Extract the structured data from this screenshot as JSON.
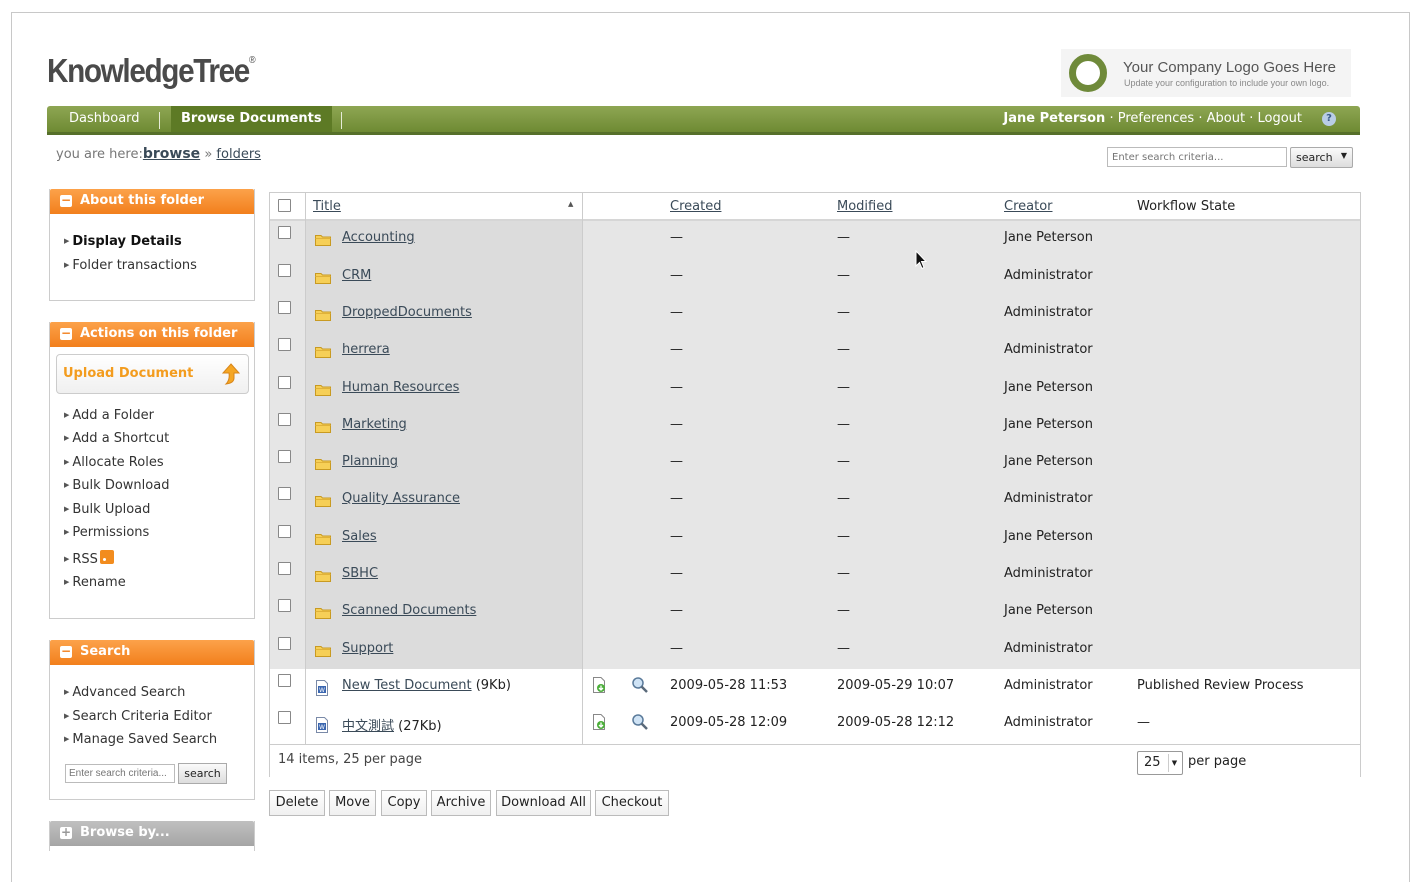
{
  "header": {
    "logo_main": "KnowledgeTree",
    "logo_mark": "®",
    "company_title": "Your Company Logo Goes Here",
    "company_sub": "Update your configuration to include your own logo."
  },
  "nav": {
    "tabs": [
      {
        "label": "Dashboard"
      },
      {
        "label": "Browse Documents"
      }
    ],
    "user": "Jane Peterson",
    "preferences": "Preferences",
    "about": "About",
    "logout": "Logout",
    "dot": "·",
    "help_glyph": "?"
  },
  "breadcrumb": {
    "prefix": "you are here:",
    "browse": "browse",
    "sep": "»",
    "folders": "folders"
  },
  "top_search": {
    "placeholder": "Enter search criteria...",
    "button": "search"
  },
  "sidebar": {
    "about": {
      "title": "About this folder",
      "items": [
        "Display Details",
        "Folder transactions"
      ]
    },
    "actions": {
      "title": "Actions on this folder",
      "upload": "Upload Document",
      "items": [
        "Add a Folder",
        "Add a Shortcut",
        "Allocate Roles",
        "Bulk Download",
        "Bulk Upload",
        "Permissions",
        "RSS",
        "Rename"
      ]
    },
    "search": {
      "title": "Search",
      "items": [
        "Advanced Search",
        "Search Criteria Editor",
        "Manage Saved Search"
      ],
      "placeholder": "Enter search criteria...",
      "button": "search"
    },
    "browse_by": {
      "title": "Browse by..."
    }
  },
  "table": {
    "headers": {
      "title": "Title",
      "created": "Created",
      "modified": "Modified",
      "creator": "Creator",
      "workflow": "Workflow State"
    },
    "rows": [
      {
        "type": "folder",
        "title": "Accounting",
        "size": "",
        "created": "—",
        "modified": "—",
        "creator": "Jane Peterson",
        "workflow": ""
      },
      {
        "type": "folder",
        "title": "CRM",
        "size": "",
        "created": "—",
        "modified": "—",
        "creator": "Administrator",
        "workflow": ""
      },
      {
        "type": "folder",
        "title": "DroppedDocuments",
        "size": "",
        "created": "—",
        "modified": "—",
        "creator": "Administrator",
        "workflow": ""
      },
      {
        "type": "folder",
        "title": "herrera",
        "size": "",
        "created": "—",
        "modified": "—",
        "creator": "Administrator",
        "workflow": ""
      },
      {
        "type": "folder",
        "title": "Human Resources",
        "size": "",
        "created": "—",
        "modified": "—",
        "creator": "Jane Peterson",
        "workflow": ""
      },
      {
        "type": "folder",
        "title": "Marketing",
        "size": "",
        "created": "—",
        "modified": "—",
        "creator": "Jane Peterson",
        "workflow": ""
      },
      {
        "type": "folder",
        "title": "Planning",
        "size": "",
        "created": "—",
        "modified": "—",
        "creator": "Jane Peterson",
        "workflow": ""
      },
      {
        "type": "folder",
        "title": "Quality Assurance",
        "size": "",
        "created": "—",
        "modified": "—",
        "creator": "Administrator",
        "workflow": ""
      },
      {
        "type": "folder",
        "title": "Sales",
        "size": "",
        "created": "—",
        "modified": "—",
        "creator": "Jane Peterson",
        "workflow": ""
      },
      {
        "type": "folder",
        "title": "SBHC",
        "size": "",
        "created": "—",
        "modified": "—",
        "creator": "Administrator",
        "workflow": ""
      },
      {
        "type": "folder",
        "title": "Scanned Documents",
        "size": "",
        "created": "—",
        "modified": "—",
        "creator": "Jane Peterson",
        "workflow": ""
      },
      {
        "type": "folder",
        "title": "Support",
        "size": "",
        "created": "—",
        "modified": "—",
        "creator": "Administrator",
        "workflow": ""
      },
      {
        "type": "document",
        "title": "New Test Document",
        "size": "(9Kb)",
        "created": "2009-05-28 11:53",
        "modified": "2009-05-29 10:07",
        "creator": "Administrator",
        "workflow": "Published Review Process"
      },
      {
        "type": "document",
        "title": "中文測試",
        "size": "(27Kb)",
        "created": "2009-05-28 12:09",
        "modified": "2009-05-28 12:12",
        "creator": "Administrator",
        "workflow": "—"
      }
    ],
    "footer": {
      "summary": "14 items, 25 per page",
      "per_page_value": "25",
      "per_page_label": "per page"
    }
  },
  "bulk_actions": [
    "Delete",
    "Move",
    "Copy",
    "Archive",
    "Download All",
    "Checkout"
  ],
  "colors": {
    "nav_green": "#6e8a33",
    "panel_orange": "#f27f1c",
    "upload_orange": "#f39c1e"
  }
}
